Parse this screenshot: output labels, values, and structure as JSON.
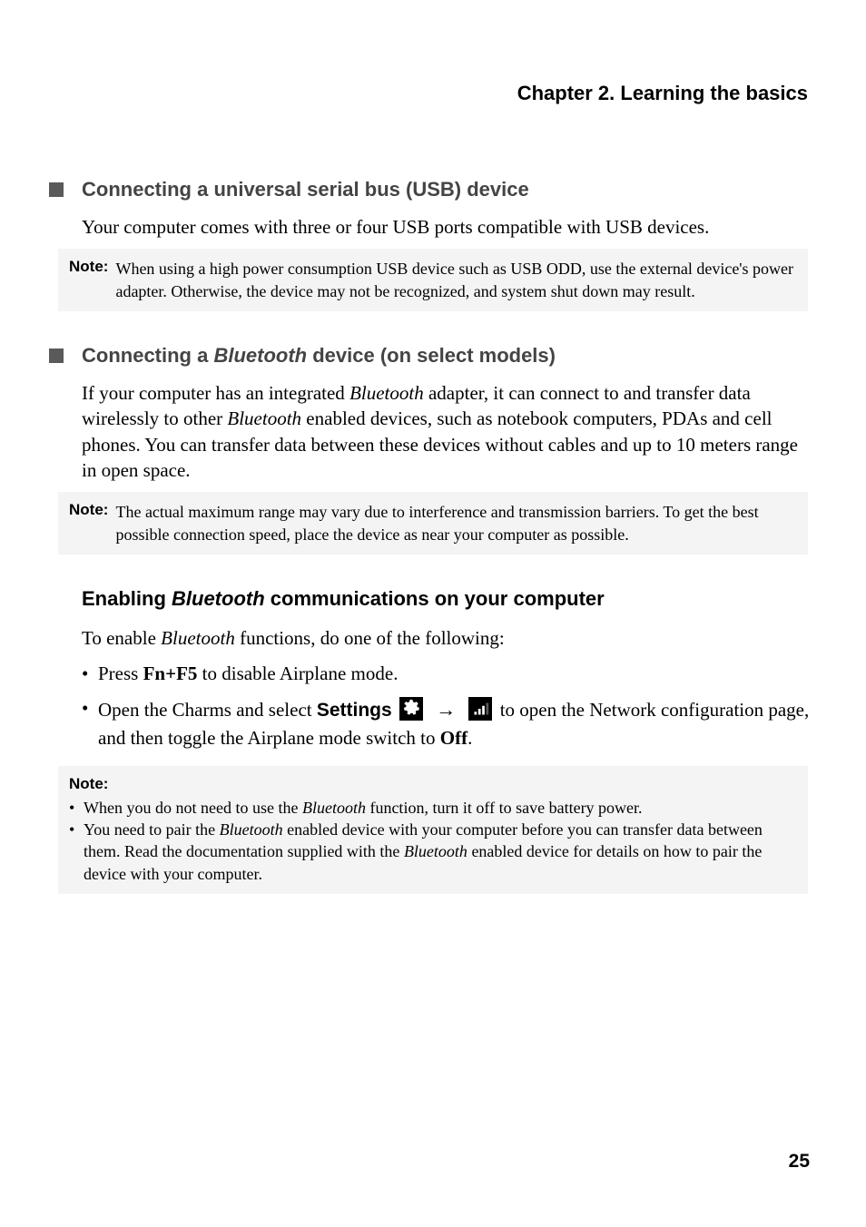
{
  "header": {
    "chapter": "Chapter 2. Learning the basics"
  },
  "section1": {
    "title": "Connecting a universal serial bus (USB) device",
    "body": "Your computer comes with three or four USB ports compatible with USB devices.",
    "note_label": "Note:",
    "note_text": "When using a high power consumption USB device such as USB ODD, use the external device's power adapter. Otherwise, the device may not be recognized, and system shut down may result."
  },
  "section2": {
    "title_pre": "Connecting a ",
    "title_italic": "Bluetooth",
    "title_post": " device (on select models)",
    "body_pre": "If your computer has an integrated ",
    "body_i1": "Bluetooth",
    "body_mid1": " adapter, it can connect to and transfer data wirelessly to other ",
    "body_i2": "Bluetooth",
    "body_mid2": " enabled devices, such as notebook computers, PDAs and cell phones. You can transfer data between these devices without cables and up to 10 meters range in open space.",
    "note_label": "Note:",
    "note_text": "The actual maximum range may vary due to interference and transmission barriers. To get the best possible connection speed, place the device as near your computer as possible."
  },
  "section3": {
    "heading_pre": "Enabling ",
    "heading_italic": "Bluetooth",
    "heading_post": " communications on your computer",
    "intro_pre": "To enable ",
    "intro_italic": "Bluetooth",
    "intro_post": " functions, do one of the following:",
    "li1_pre": "Press ",
    "li1_bold": "Fn+F5",
    "li1_post": " to disable Airplane mode.",
    "li2_pre": "Open the Charms and select  ",
    "li2_settings": "Settings",
    "li2_mid": "  to open the Network configuration page, and then toggle the Airplane mode switch to ",
    "li2_off": "Off",
    "li2_end": "."
  },
  "section4": {
    "note_label": "Note:",
    "li1_pre": "When you do not need to use the ",
    "li1_i": "Bluetooth",
    "li1_post": " function, turn it off to save battery power.",
    "li2_pre": "You need to pair the ",
    "li2_i1": "Bluetooth",
    "li2_mid1": " enabled device with your computer before you can transfer data between them. Read the documentation supplied with the ",
    "li2_i2": "Bluetooth",
    "li2_mid2": " enabled device for details on how to pair the device with your computer."
  },
  "page_number": "25",
  "icons": {
    "settings": "gear-icon",
    "network": "signal-icon",
    "arrow": "→"
  }
}
